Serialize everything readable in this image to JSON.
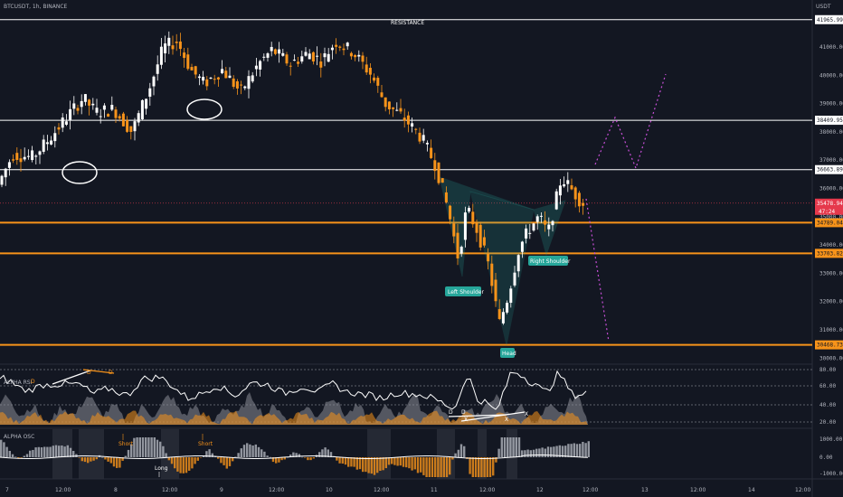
{
  "header": {
    "symbol_label": "BTCUSDT, 1h, BINANCE",
    "currency": "USDT"
  },
  "annotations": {
    "resistance": "RESISTANCE",
    "left_shoulder": "Left Shoulder",
    "right_shoulder": "Right Shoulder",
    "head": "Head"
  },
  "price_axis": {
    "ticks": [
      "41000.00",
      "40000.00",
      "39000.00",
      "38000.00",
      "37000.00",
      "36000.00",
      "35000.00",
      "34000.00",
      "33000.00",
      "32000.00",
      "31000.00",
      "30000.00"
    ]
  },
  "levels": [
    {
      "price": "41965.99",
      "color": "#ffffff"
    },
    {
      "price": "38409.95",
      "color": "#ffffff"
    },
    {
      "price": "36663.89",
      "color": "#ffffff"
    },
    {
      "price": "34789.04",
      "color": "#f7931a"
    },
    {
      "price": "33703.82",
      "color": "#f7931a"
    },
    {
      "price": "30468.73",
      "color": "#f7931a"
    }
  ],
  "current_price": {
    "price": "35478.94",
    "countdown": "47:24",
    "color": "#e5394c"
  },
  "rsi_panel": {
    "title": "ALPHA RSI",
    "ticks": [
      "80.00",
      "60.00",
      "40.00",
      "20.00"
    ],
    "markers": [
      "D",
      "D",
      "D",
      "D",
      "D",
      "X",
      "X",
      "X"
    ]
  },
  "osc_panel": {
    "title": "ALPHA OSC",
    "ticks": [
      "1000.00",
      "0.00",
      "-1000.00"
    ],
    "markers": [
      "Short",
      "Short",
      "Long"
    ]
  },
  "time_axis": [
    "7",
    "12:00",
    "8",
    "12:00",
    "9",
    "12:00",
    "10",
    "12:00",
    "11",
    "12:00",
    "12",
    "12:00",
    "13",
    "12:00",
    "14",
    "12:00"
  ],
  "colors": {
    "up": "#ffffff",
    "down": "#f7931a",
    "projection": "#c84fd8",
    "pattern": "#26a69a",
    "background": "#131722"
  }
}
